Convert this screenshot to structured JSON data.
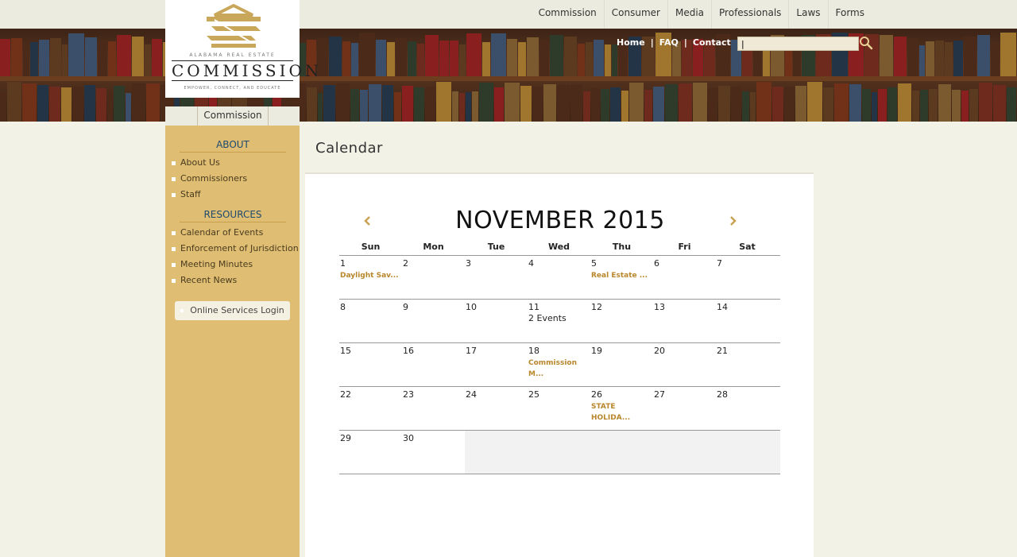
{
  "top_nav": [
    "Commission",
    "Consumer",
    "Media",
    "Professionals",
    "Laws",
    "Forms"
  ],
  "util_nav": [
    "Home",
    "FAQ",
    "Contact"
  ],
  "search": {
    "value": "|"
  },
  "logo": {
    "line1": "ALABAMA REAL ESTATE",
    "word": "COMMISSION",
    "tagline": "EMPOWER, CONNECT, AND EDUCATE"
  },
  "sidebar": {
    "tab": "Commission",
    "about_heading": "ABOUT",
    "about_items": [
      "About Us",
      "Commissioners",
      "Staff"
    ],
    "resources_heading": "RESOURCES",
    "resources_items": [
      "Calendar of Events",
      "Enforcement of Jurisdiction",
      "Meeting Minutes",
      "Recent News"
    ],
    "login_label": "Online Services Login"
  },
  "page_title": "Calendar",
  "calendar": {
    "month_title": "NOVEMBER 2015",
    "weekdays": [
      "Sun",
      "Mon",
      "Tue",
      "Wed",
      "Thu",
      "Fri",
      "Sat"
    ],
    "weeks": [
      [
        {
          "n": "1",
          "ev": "Daylight Sav..."
        },
        {
          "n": "2"
        },
        {
          "n": "3"
        },
        {
          "n": "4"
        },
        {
          "n": "5",
          "ev": "Real Estate ..."
        },
        {
          "n": "6"
        },
        {
          "n": "7"
        }
      ],
      [
        {
          "n": "8"
        },
        {
          "n": "9"
        },
        {
          "n": "10"
        },
        {
          "n": "11",
          "plain": "2 Events"
        },
        {
          "n": "12"
        },
        {
          "n": "13"
        },
        {
          "n": "14"
        }
      ],
      [
        {
          "n": "15"
        },
        {
          "n": "16"
        },
        {
          "n": "17"
        },
        {
          "n": "18",
          "ev": "Commission M..."
        },
        {
          "n": "19"
        },
        {
          "n": "20"
        },
        {
          "n": "21"
        }
      ],
      [
        {
          "n": "22"
        },
        {
          "n": "23"
        },
        {
          "n": "24"
        },
        {
          "n": "25"
        },
        {
          "n": "26",
          "ev": "STATE HOLIDA..."
        },
        {
          "n": "27"
        },
        {
          "n": "28"
        }
      ],
      [
        {
          "n": "29"
        },
        {
          "n": "30"
        }
      ]
    ]
  },
  "colors": {
    "accent_gold": "#b8862b",
    "sidebar_bg": "#dfbe73",
    "heading_blue": "#1e4a6e"
  },
  "icons": [
    "search-icon",
    "chevron-left-icon",
    "chevron-right-icon"
  ]
}
